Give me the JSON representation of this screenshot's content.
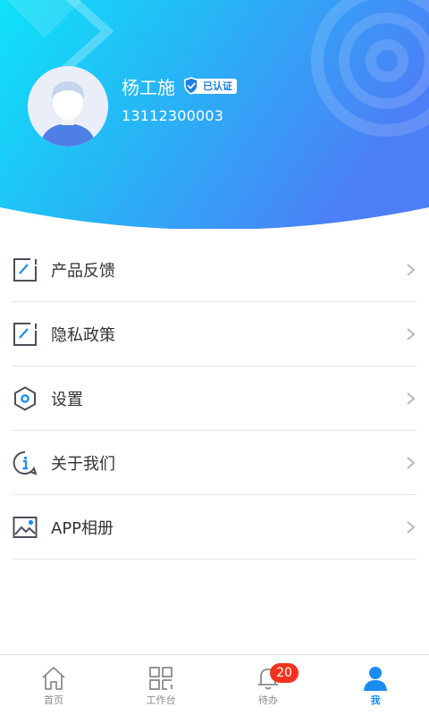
{
  "profile": {
    "name": "杨工施",
    "verified_label": "已认证",
    "phone": "13112300003"
  },
  "menu": {
    "items": [
      {
        "label": "产品反馈",
        "icon": "feedback-icon"
      },
      {
        "label": "隐私政策",
        "icon": "privacy-icon"
      },
      {
        "label": "设置",
        "icon": "settings-hexagon-icon"
      },
      {
        "label": "关于我们",
        "icon": "info-icon"
      },
      {
        "label": "APP相册",
        "icon": "photo-album-icon"
      }
    ]
  },
  "tabbar": {
    "tabs": [
      {
        "label": "首页",
        "icon": "home-icon"
      },
      {
        "label": "工作台",
        "icon": "grid-icon"
      },
      {
        "label": "待办",
        "icon": "bell-icon",
        "badge": "20"
      },
      {
        "label": "我",
        "icon": "person-icon"
      }
    ],
    "active_index": 3
  },
  "colors": {
    "header_gradient_start": "#10d6f6",
    "header_gradient_end": "#4a83f6",
    "accent": "#1a8cf0",
    "badge": "#f2331f"
  }
}
